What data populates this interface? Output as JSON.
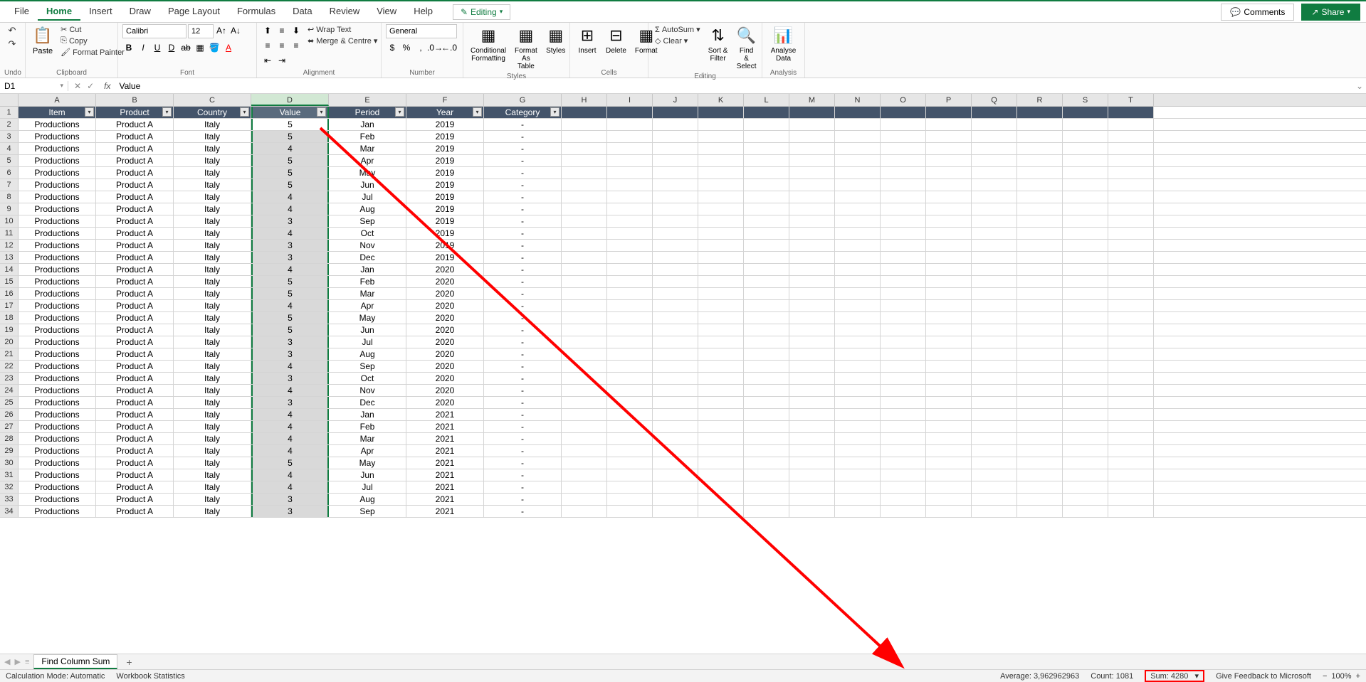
{
  "menu": {
    "tabs": [
      "File",
      "Home",
      "Insert",
      "Draw",
      "Page Layout",
      "Formulas",
      "Data",
      "Review",
      "View",
      "Help"
    ],
    "active": "Home",
    "editing": "Editing",
    "comments": "Comments",
    "share": "Share"
  },
  "ribbon": {
    "undo": "Undo",
    "clipboard": {
      "paste": "Paste",
      "cut": "Cut",
      "copy": "Copy",
      "painter": "Format Painter",
      "label": "Clipboard"
    },
    "font": {
      "name": "Calibri",
      "size": "12",
      "label": "Font"
    },
    "alignment": {
      "wrap": "Wrap Text",
      "merge": "Merge & Centre",
      "label": "Alignment"
    },
    "number": {
      "format": "General",
      "label": "Number"
    },
    "styles": {
      "cond": "Conditional Formatting",
      "table": "Format As Table",
      "styles": "Styles",
      "label": "Styles"
    },
    "cells": {
      "insert": "Insert",
      "delete": "Delete",
      "format": "Format",
      "label": "Cells"
    },
    "editing": {
      "autosum": "AutoSum",
      "clear": "Clear",
      "sort": "Sort & Filter",
      "find": "Find & Select",
      "label": "Editing"
    },
    "analysis": {
      "analyse": "Analyse Data",
      "label": "Analysis"
    }
  },
  "namebox": "D1",
  "formula": "Value",
  "columns": [
    "A",
    "B",
    "C",
    "D",
    "E",
    "F",
    "G",
    "H",
    "I",
    "J",
    "K",
    "L",
    "M",
    "N",
    "O",
    "P",
    "Q",
    "R",
    "S",
    "T"
  ],
  "headers": [
    "Item",
    "Product",
    "Country",
    "Value",
    "Period",
    "Year",
    "Category"
  ],
  "rows": [
    {
      "n": 2,
      "item": "Productions",
      "product": "Product A",
      "country": "Italy",
      "value": "5",
      "period": "Jan",
      "year": "2019",
      "cat": "-"
    },
    {
      "n": 3,
      "item": "Productions",
      "product": "Product A",
      "country": "Italy",
      "value": "5",
      "period": "Feb",
      "year": "2019",
      "cat": "-"
    },
    {
      "n": 4,
      "item": "Productions",
      "product": "Product A",
      "country": "Italy",
      "value": "4",
      "period": "Mar",
      "year": "2019",
      "cat": "-"
    },
    {
      "n": 5,
      "item": "Productions",
      "product": "Product A",
      "country": "Italy",
      "value": "5",
      "period": "Apr",
      "year": "2019",
      "cat": "-"
    },
    {
      "n": 6,
      "item": "Productions",
      "product": "Product A",
      "country": "Italy",
      "value": "5",
      "period": "May",
      "year": "2019",
      "cat": "-"
    },
    {
      "n": 7,
      "item": "Productions",
      "product": "Product A",
      "country": "Italy",
      "value": "5",
      "period": "Jun",
      "year": "2019",
      "cat": "-"
    },
    {
      "n": 8,
      "item": "Productions",
      "product": "Product A",
      "country": "Italy",
      "value": "4",
      "period": "Jul",
      "year": "2019",
      "cat": "-"
    },
    {
      "n": 9,
      "item": "Productions",
      "product": "Product A",
      "country": "Italy",
      "value": "4",
      "period": "Aug",
      "year": "2019",
      "cat": "-"
    },
    {
      "n": 10,
      "item": "Productions",
      "product": "Product A",
      "country": "Italy",
      "value": "3",
      "period": "Sep",
      "year": "2019",
      "cat": "-"
    },
    {
      "n": 11,
      "item": "Productions",
      "product": "Product A",
      "country": "Italy",
      "value": "4",
      "period": "Oct",
      "year": "2019",
      "cat": "-"
    },
    {
      "n": 12,
      "item": "Productions",
      "product": "Product A",
      "country": "Italy",
      "value": "3",
      "period": "Nov",
      "year": "2019",
      "cat": "-"
    },
    {
      "n": 13,
      "item": "Productions",
      "product": "Product A",
      "country": "Italy",
      "value": "3",
      "period": "Dec",
      "year": "2019",
      "cat": "-"
    },
    {
      "n": 14,
      "item": "Productions",
      "product": "Product A",
      "country": "Italy",
      "value": "4",
      "period": "Jan",
      "year": "2020",
      "cat": "-"
    },
    {
      "n": 15,
      "item": "Productions",
      "product": "Product A",
      "country": "Italy",
      "value": "5",
      "period": "Feb",
      "year": "2020",
      "cat": "-"
    },
    {
      "n": 16,
      "item": "Productions",
      "product": "Product A",
      "country": "Italy",
      "value": "5",
      "period": "Mar",
      "year": "2020",
      "cat": "-"
    },
    {
      "n": 17,
      "item": "Productions",
      "product": "Product A",
      "country": "Italy",
      "value": "4",
      "period": "Apr",
      "year": "2020",
      "cat": "-"
    },
    {
      "n": 18,
      "item": "Productions",
      "product": "Product A",
      "country": "Italy",
      "value": "5",
      "period": "May",
      "year": "2020",
      "cat": "-"
    },
    {
      "n": 19,
      "item": "Productions",
      "product": "Product A",
      "country": "Italy",
      "value": "5",
      "period": "Jun",
      "year": "2020",
      "cat": "-"
    },
    {
      "n": 20,
      "item": "Productions",
      "product": "Product A",
      "country": "Italy",
      "value": "3",
      "period": "Jul",
      "year": "2020",
      "cat": "-"
    },
    {
      "n": 21,
      "item": "Productions",
      "product": "Product A",
      "country": "Italy",
      "value": "3",
      "period": "Aug",
      "year": "2020",
      "cat": "-"
    },
    {
      "n": 22,
      "item": "Productions",
      "product": "Product A",
      "country": "Italy",
      "value": "4",
      "period": "Sep",
      "year": "2020",
      "cat": "-"
    },
    {
      "n": 23,
      "item": "Productions",
      "product": "Product A",
      "country": "Italy",
      "value": "3",
      "period": "Oct",
      "year": "2020",
      "cat": "-"
    },
    {
      "n": 24,
      "item": "Productions",
      "product": "Product A",
      "country": "Italy",
      "value": "4",
      "period": "Nov",
      "year": "2020",
      "cat": "-"
    },
    {
      "n": 25,
      "item": "Productions",
      "product": "Product A",
      "country": "Italy",
      "value": "3",
      "period": "Dec",
      "year": "2020",
      "cat": "-"
    },
    {
      "n": 26,
      "item": "Productions",
      "product": "Product A",
      "country": "Italy",
      "value": "4",
      "period": "Jan",
      "year": "2021",
      "cat": "-"
    },
    {
      "n": 27,
      "item": "Productions",
      "product": "Product A",
      "country": "Italy",
      "value": "4",
      "period": "Feb",
      "year": "2021",
      "cat": "-"
    },
    {
      "n": 28,
      "item": "Productions",
      "product": "Product A",
      "country": "Italy",
      "value": "4",
      "period": "Mar",
      "year": "2021",
      "cat": "-"
    },
    {
      "n": 29,
      "item": "Productions",
      "product": "Product A",
      "country": "Italy",
      "value": "4",
      "period": "Apr",
      "year": "2021",
      "cat": "-"
    },
    {
      "n": 30,
      "item": "Productions",
      "product": "Product A",
      "country": "Italy",
      "value": "5",
      "period": "May",
      "year": "2021",
      "cat": "-"
    },
    {
      "n": 31,
      "item": "Productions",
      "product": "Product A",
      "country": "Italy",
      "value": "4",
      "period": "Jun",
      "year": "2021",
      "cat": "-"
    },
    {
      "n": 32,
      "item": "Productions",
      "product": "Product A",
      "country": "Italy",
      "value": "4",
      "period": "Jul",
      "year": "2021",
      "cat": "-"
    },
    {
      "n": 33,
      "item": "Productions",
      "product": "Product A",
      "country": "Italy",
      "value": "3",
      "period": "Aug",
      "year": "2021",
      "cat": "-"
    },
    {
      "n": 34,
      "item": "Productions",
      "product": "Product A",
      "country": "Italy",
      "value": "3",
      "period": "Sep",
      "year": "2021",
      "cat": "-"
    }
  ],
  "sheet": {
    "name": "Find Column Sum"
  },
  "status": {
    "calc": "Calculation Mode: Automatic",
    "wb": "Workbook Statistics",
    "avg": "Average: 3,962962963",
    "count": "Count: 1081",
    "sum": "Sum: 4280",
    "feedback": "Give Feedback to Microsoft",
    "zoom": "100%"
  }
}
